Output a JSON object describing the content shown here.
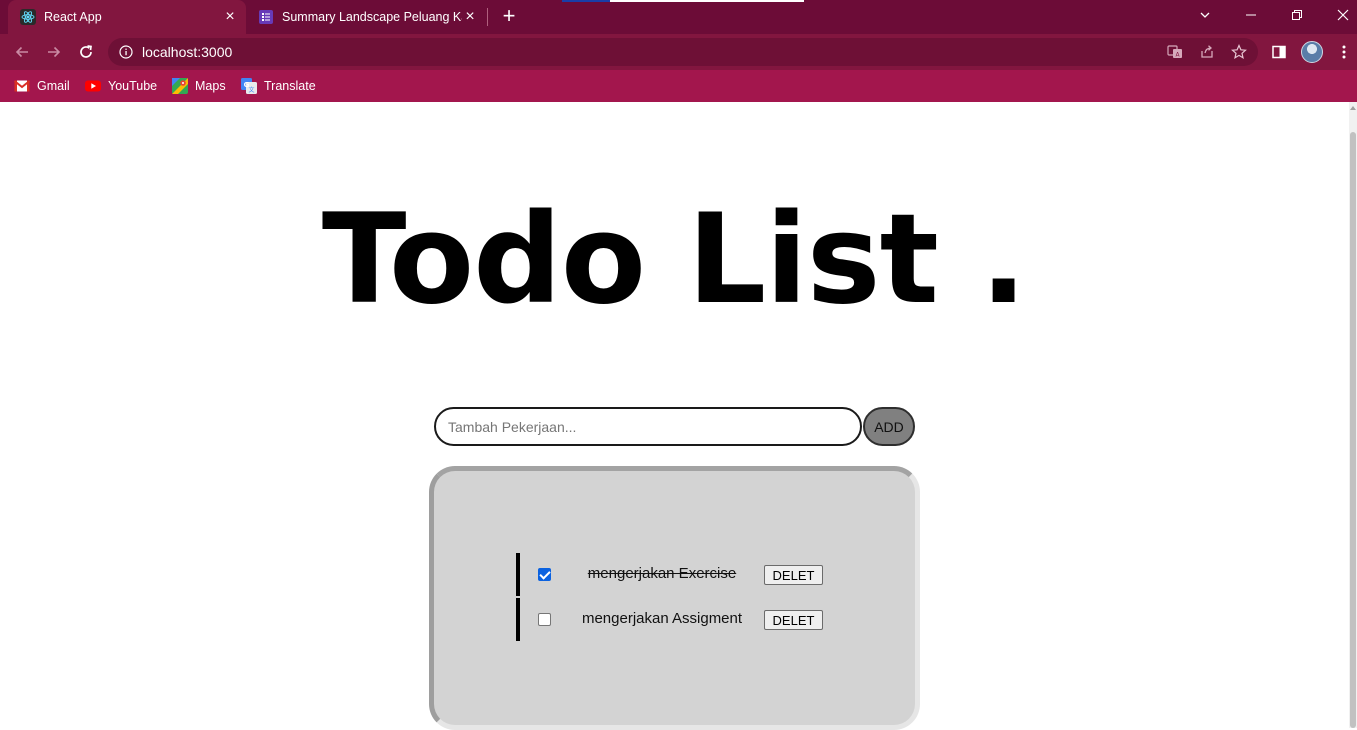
{
  "browser": {
    "tabs": [
      {
        "title": "React App",
        "active": true,
        "icon": "react-icon"
      },
      {
        "title": "Summary Landscape Peluang Kar",
        "active": false,
        "icon": "forms-icon"
      }
    ],
    "address": "localhost:3000",
    "bookmarks": [
      {
        "label": "Gmail",
        "icon": "gmail-icon"
      },
      {
        "label": "YouTube",
        "icon": "youtube-icon"
      },
      {
        "label": "Maps",
        "icon": "maps-icon"
      },
      {
        "label": "Translate",
        "icon": "translate-icon"
      }
    ],
    "colors": {
      "tabstrip": "#6c0c37",
      "toolbar": "#82163f",
      "bookmarks_bar": "#a3164d"
    }
  },
  "app": {
    "title": "Todo List .",
    "input": {
      "placeholder": "Tambah Pekerjaan...",
      "value": ""
    },
    "add_label": "ADD",
    "todos": [
      {
        "text": "mengerjakan Exercise",
        "done": true,
        "delete_label": "DELET"
      },
      {
        "text": "mengerjakan Assigment",
        "done": false,
        "delete_label": "DELET"
      }
    ],
    "colors": {
      "list_bg": "#d3d3d3",
      "add_button": "#808080",
      "checkbox_checked": "#0b62e0"
    }
  }
}
